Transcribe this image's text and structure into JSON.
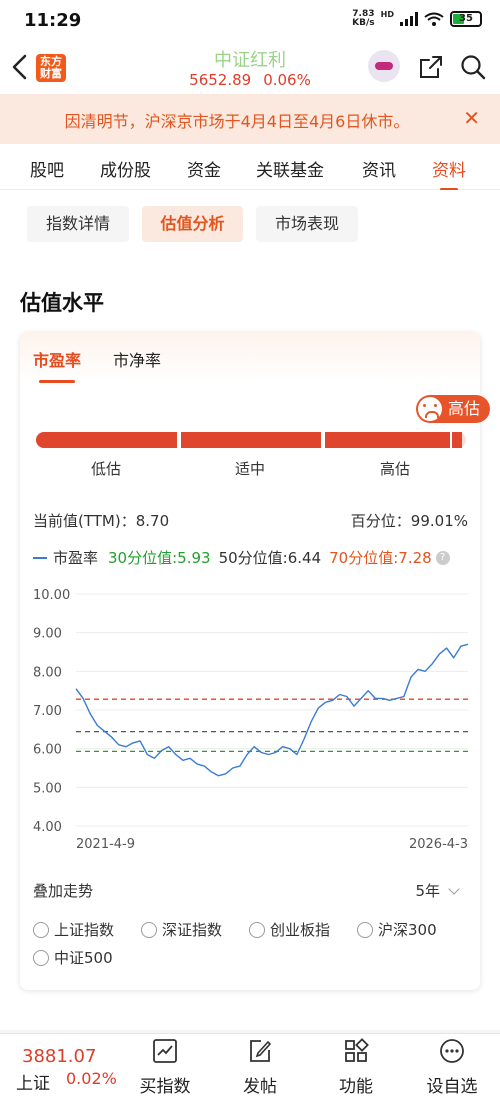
{
  "status_bar": {
    "time": "11:29",
    "net_speed_value": "7.83",
    "net_speed_unit": "KB/s",
    "net_type": "HD",
    "battery": "35"
  },
  "header": {
    "logo_text": "东方财富",
    "title": "中证红利",
    "price": "5652.89",
    "change": "0.06%"
  },
  "notice": {
    "text": "因清明节，沪深京市场于4月4日至4月6日休市。",
    "close": "✕"
  },
  "tabs": [
    "股吧",
    "成份股",
    "资金",
    "关联基金",
    "资讯",
    "资料"
  ],
  "active_tab": "资料",
  "subtabs": [
    "指数详情",
    "估值分析",
    "市场表现"
  ],
  "active_subtab": "估值分析",
  "section_title": "估值水平",
  "metric_tabs": [
    "市盈率",
    "市净率"
  ],
  "active_metric": "市盈率",
  "valuation": {
    "badge": "高估",
    "levels": [
      "低估",
      "适中",
      "高估"
    ],
    "level_fraction": 0.9901,
    "current_label": "当前值(TTM)：",
    "current_value": "8.70",
    "percentile_label": "百分位：",
    "percentile_value": "99.01%"
  },
  "legend": {
    "series": "市盈率",
    "p30_label": "30分位值:",
    "p30_value": "5.93",
    "p50_label": "50分位值:",
    "p50_value": "6.44",
    "p70_label": "70分位值:",
    "p70_value": "7.28",
    "help": "?"
  },
  "colors": {
    "accent": "#e84c1e",
    "line": "#3a7bd5",
    "p30": "#22a02f",
    "p50": "#555555",
    "p70": "#e0452e",
    "rise": "#e03c2a"
  },
  "chart_data": {
    "type": "line",
    "x_start": "2021-4-9",
    "x_end": "2026-4-3",
    "y_ticks": [
      "10.00",
      "9.00",
      "8.00",
      "7.00",
      "6.00",
      "5.00",
      "4.00"
    ],
    "ylim": [
      4,
      10
    ],
    "series": [
      {
        "name": "市盈率",
        "values": [
          7.55,
          7.3,
          6.9,
          6.6,
          6.45,
          6.3,
          6.1,
          6.05,
          6.15,
          6.2,
          5.85,
          5.75,
          5.95,
          6.05,
          5.85,
          5.7,
          5.75,
          5.6,
          5.55,
          5.4,
          5.3,
          5.35,
          5.5,
          5.55,
          5.85,
          6.05,
          5.9,
          5.85,
          5.9,
          6.05,
          6.0,
          5.85,
          6.25,
          6.7,
          7.05,
          7.2,
          7.25,
          7.4,
          7.35,
          7.1,
          7.3,
          7.5,
          7.3,
          7.3,
          7.25,
          7.3,
          7.35,
          7.85,
          8.05,
          8.0,
          8.2,
          8.45,
          8.6,
          8.35,
          8.65,
          8.7
        ]
      }
    ],
    "reference_lines": [
      {
        "name": "70分位值",
        "value": 7.28
      },
      {
        "name": "50分位值",
        "value": 6.44
      },
      {
        "name": "30分位值",
        "value": 5.93
      }
    ]
  },
  "overlay": {
    "title": "叠加走势",
    "range": "5年",
    "options": [
      "上证指数",
      "深证指数",
      "创业板指",
      "沪深300",
      "中证500"
    ]
  },
  "bottom": {
    "index_price": "3881.07",
    "index_name": "上证",
    "index_change": "0.02%",
    "nav": [
      "买指数",
      "发帖",
      "功能",
      "设自选"
    ]
  }
}
